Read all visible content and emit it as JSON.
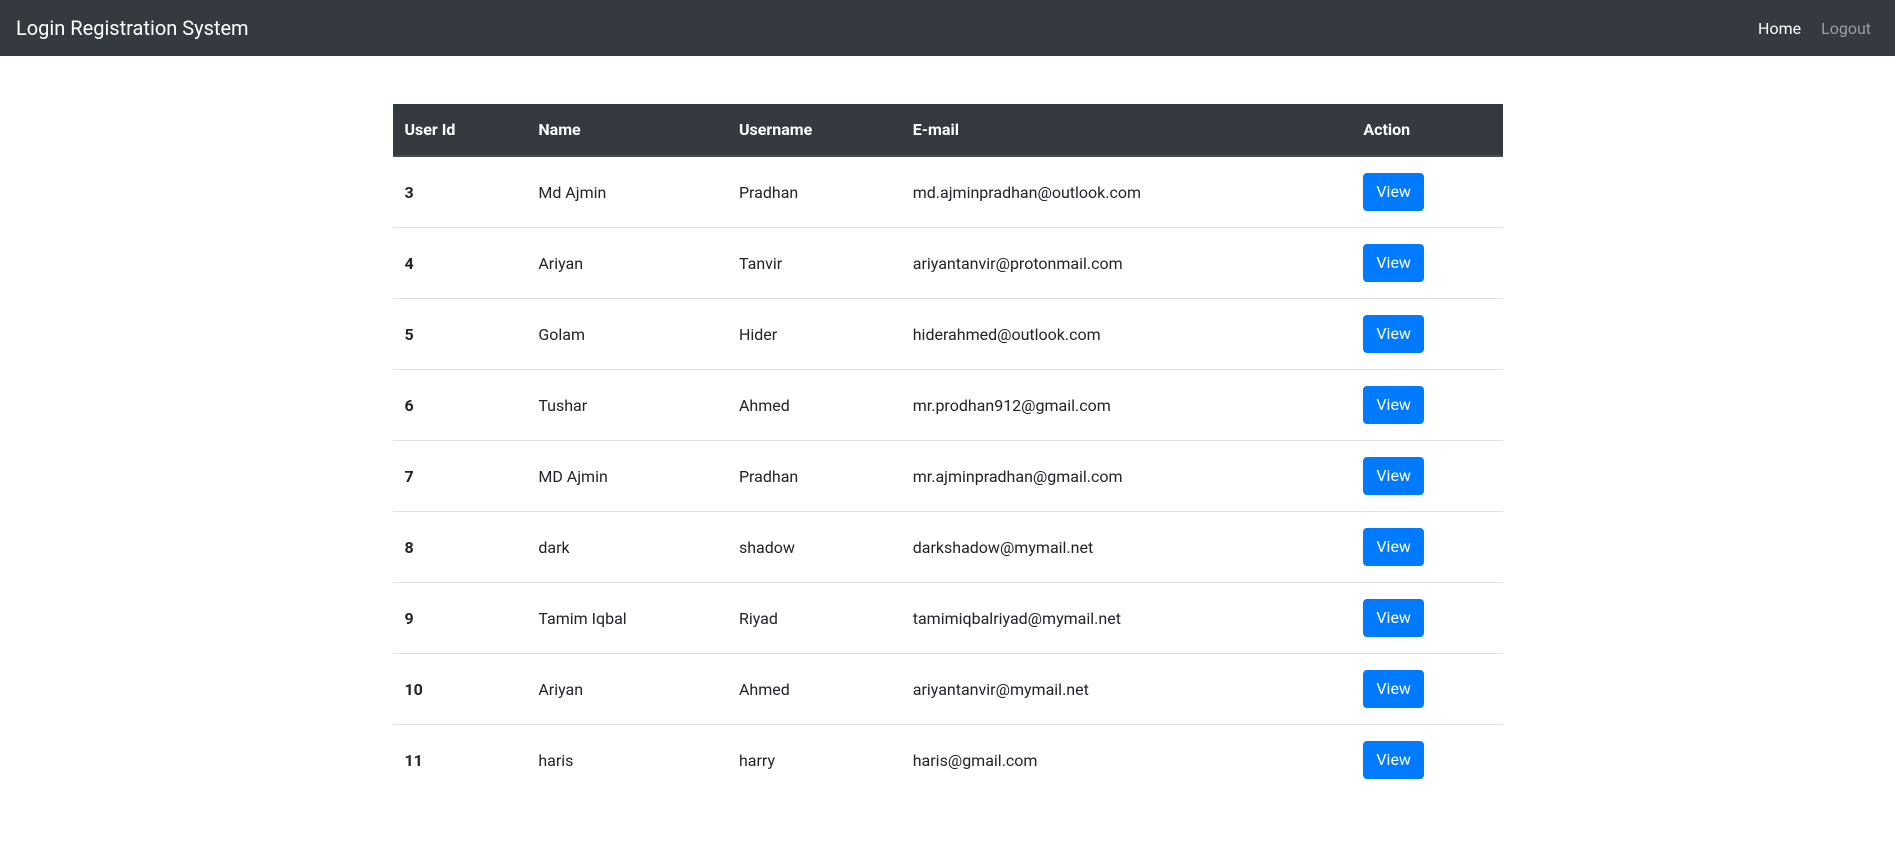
{
  "navbar": {
    "brand": "Login Registration System",
    "links": [
      {
        "label": "Home",
        "active": true
      },
      {
        "label": "Logout",
        "active": false
      }
    ]
  },
  "table": {
    "headers": {
      "user_id": "User Id",
      "name": "Name",
      "username": "Username",
      "email": "E-mail",
      "action": "Action"
    },
    "action_label": "View",
    "rows": [
      {
        "id": "3",
        "name": "Md Ajmin",
        "username": "Pradhan",
        "email": "md.ajminpradhan@outlook.com"
      },
      {
        "id": "4",
        "name": "Ariyan",
        "username": "Tanvir",
        "email": "ariyantanvir@protonmail.com"
      },
      {
        "id": "5",
        "name": "Golam",
        "username": "Hider",
        "email": "hiderahmed@outlook.com"
      },
      {
        "id": "6",
        "name": "Tushar",
        "username": "Ahmed",
        "email": "mr.prodhan912@gmail.com"
      },
      {
        "id": "7",
        "name": "MD Ajmin",
        "username": "Pradhan",
        "email": "mr.ajminpradhan@gmail.com"
      },
      {
        "id": "8",
        "name": "dark",
        "username": "shadow",
        "email": "darkshadow@mymail.net"
      },
      {
        "id": "9",
        "name": "Tamim Iqbal",
        "username": "Riyad",
        "email": "tamimiqbalriyad@mymail.net"
      },
      {
        "id": "10",
        "name": "Ariyan",
        "username": "Ahmed",
        "email": "ariyantanvir@mymail.net"
      },
      {
        "id": "11",
        "name": "haris",
        "username": "harry",
        "email": "haris@gmail.com"
      }
    ]
  }
}
